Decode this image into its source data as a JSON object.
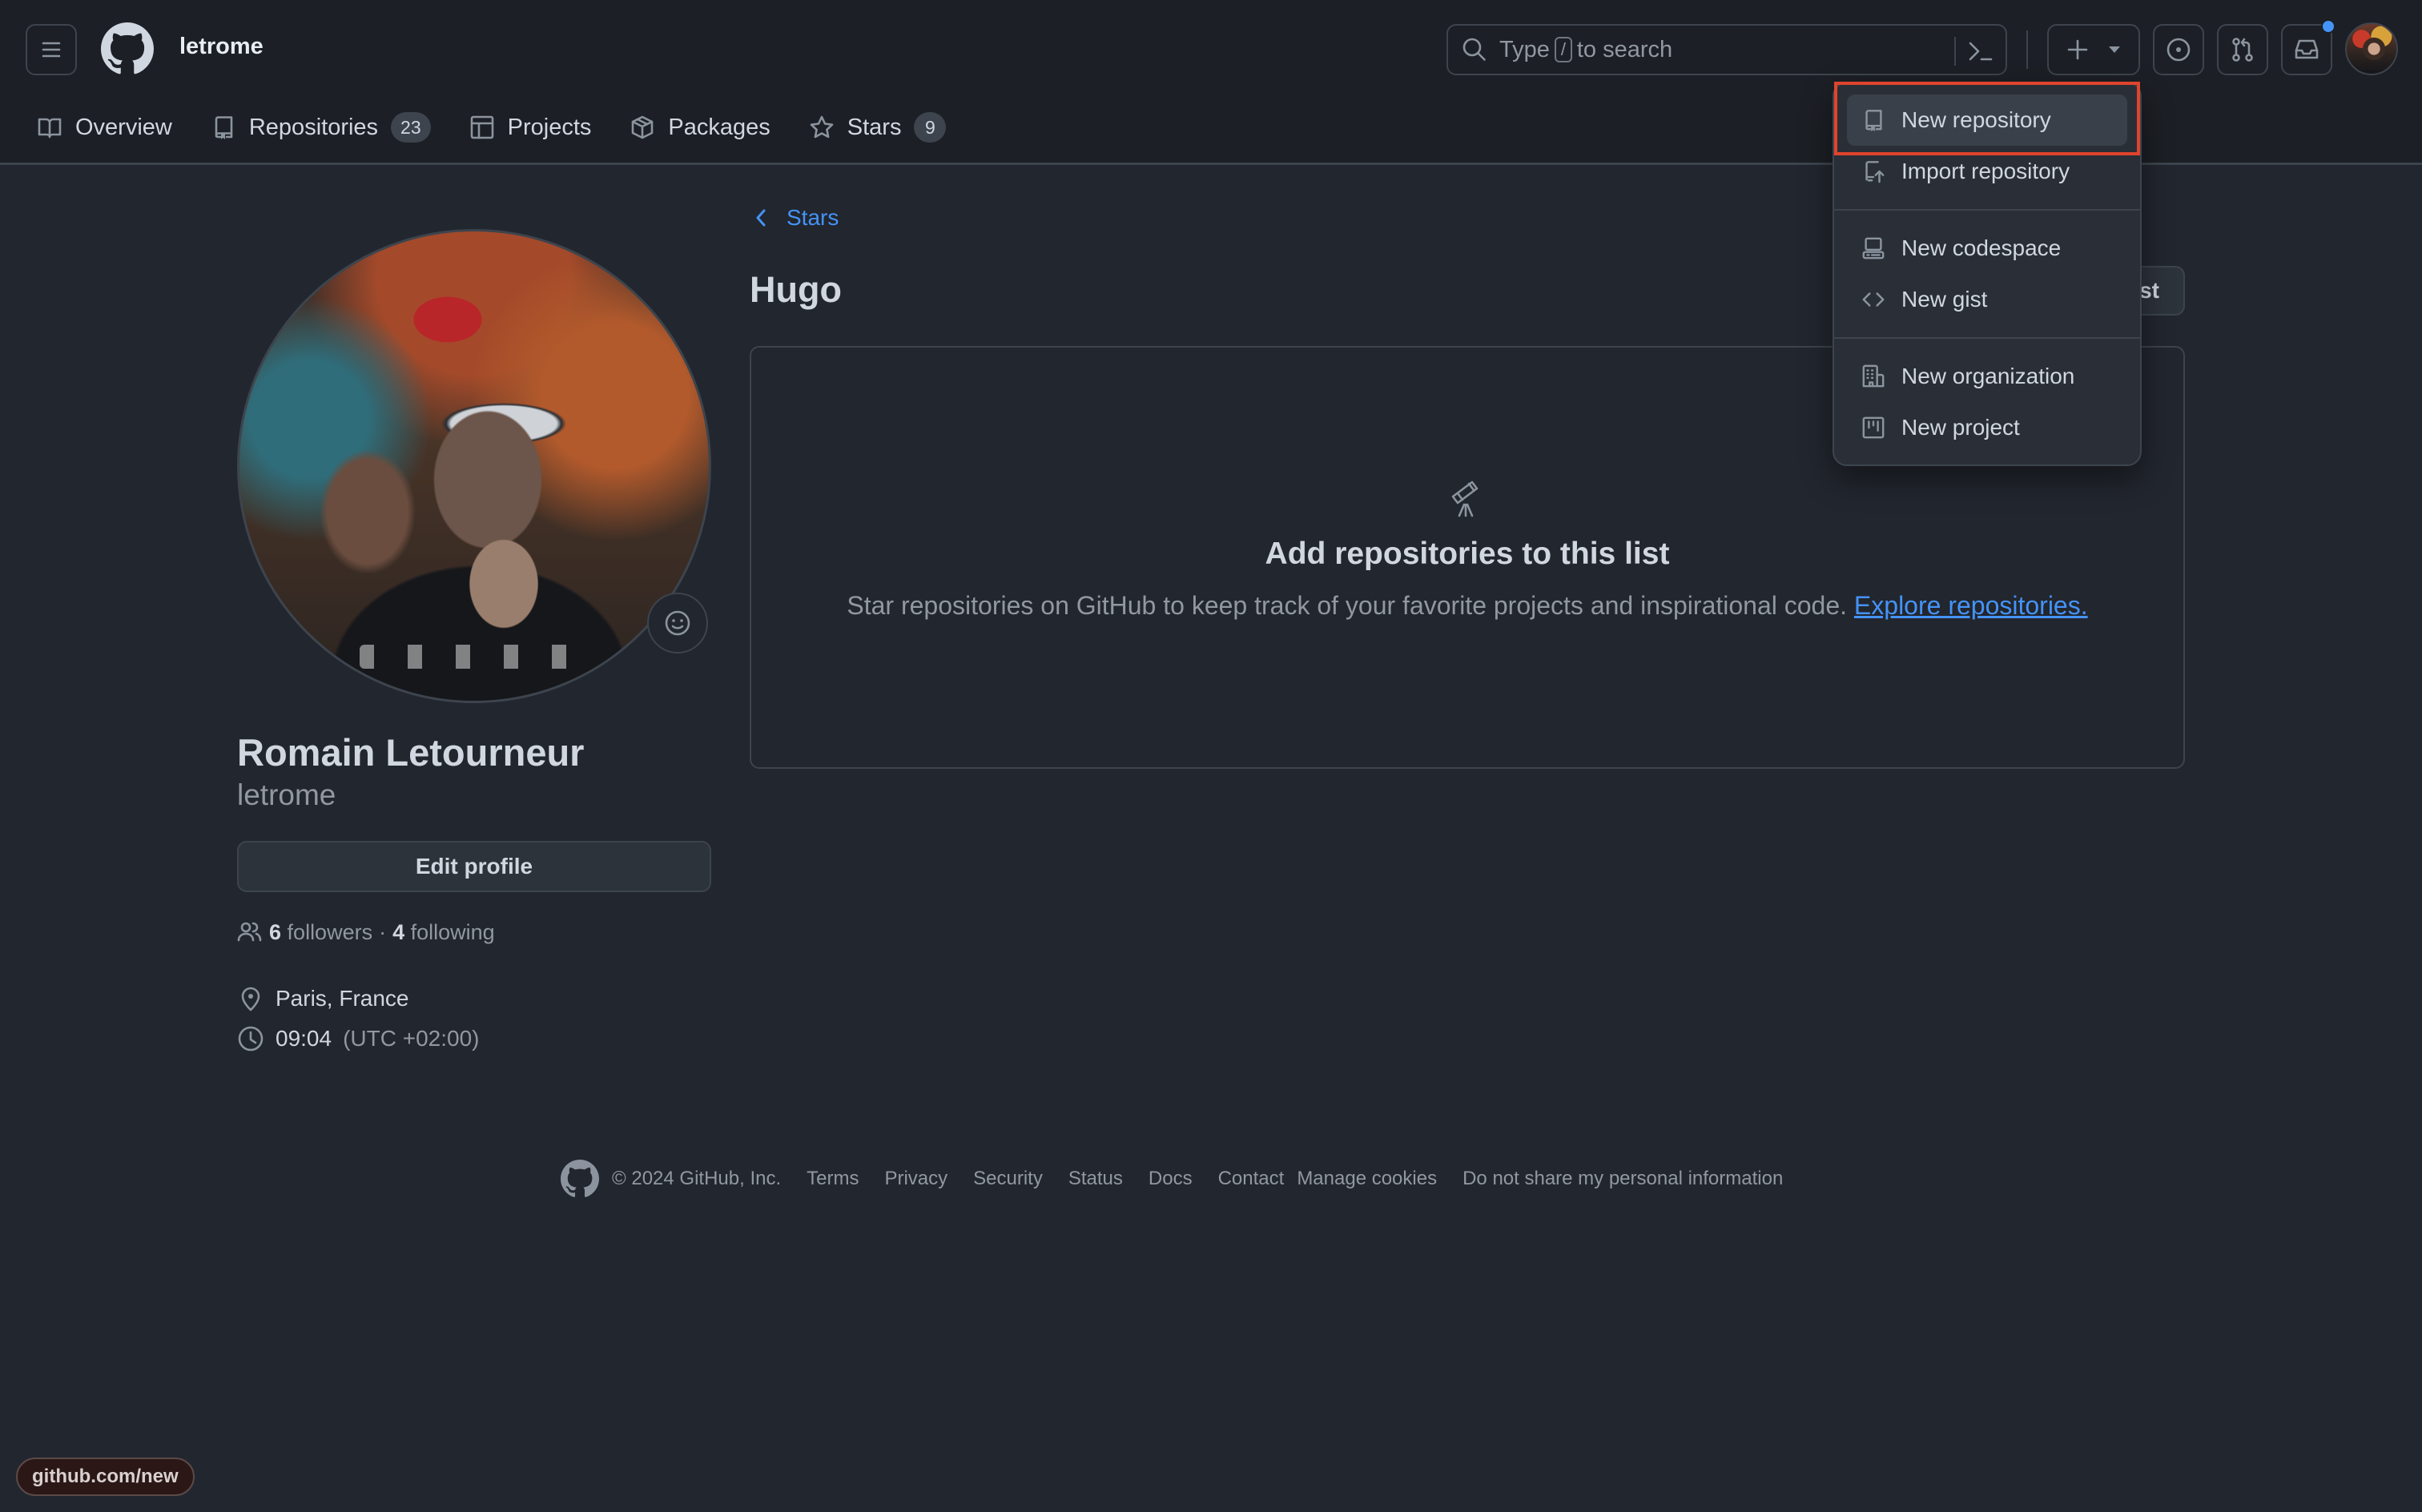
{
  "header": {
    "owner": "letrome",
    "search": {
      "prefix": "Type",
      "key": "/",
      "suffix": "to search"
    },
    "has_notification": true
  },
  "nav": {
    "tabs": [
      {
        "label": "Overview",
        "icon": "book-icon"
      },
      {
        "label": "Repositories",
        "icon": "repo-icon",
        "count": "23"
      },
      {
        "label": "Projects",
        "icon": "table-icon"
      },
      {
        "label": "Packages",
        "icon": "package-icon"
      },
      {
        "label": "Stars",
        "icon": "star-icon",
        "count": "9"
      }
    ]
  },
  "profile": {
    "full_name": "Romain Letourneur",
    "username": "letrome",
    "edit_profile_label": "Edit profile",
    "followers_count": "6",
    "followers_label": "followers",
    "separator": "·",
    "following_count": "4",
    "following_label": "following",
    "location": "Paris, France",
    "local_time": "09:04",
    "timezone": "(UTC +02:00)"
  },
  "main": {
    "back_label": "Stars",
    "list_title": "Hugo",
    "edit_list_label": "Edit list",
    "edit_list_visible": "st",
    "blankslate": {
      "title": "Add repositories to this list",
      "description": "Star repositories on GitHub to keep track of your favorite projects and inspirational code.",
      "link_label": "Explore repositories."
    }
  },
  "footer": {
    "copyright": "© 2024 GitHub, Inc.",
    "links": [
      "Terms",
      "Privacy",
      "Security",
      "Status",
      "Docs",
      "Contact",
      "Manage cookies",
      "Do not share my personal information"
    ]
  },
  "create_menu": {
    "groups": [
      [
        {
          "label": "New repository",
          "icon": "repo-icon",
          "active": true
        },
        {
          "label": "Import repository",
          "icon": "repo-push-icon"
        }
      ],
      [
        {
          "label": "New codespace",
          "icon": "codespaces-icon"
        },
        {
          "label": "New gist",
          "icon": "code-icon"
        }
      ],
      [
        {
          "label": "New organization",
          "icon": "organization-icon"
        },
        {
          "label": "New project",
          "icon": "project-icon"
        }
      ]
    ]
  },
  "status_bar": {
    "url": "github.com/new"
  },
  "colors": {
    "accent": "#4493f8",
    "background": "#22262e",
    "header_bg": "#1c1f25",
    "highlight": "#e0442d"
  }
}
